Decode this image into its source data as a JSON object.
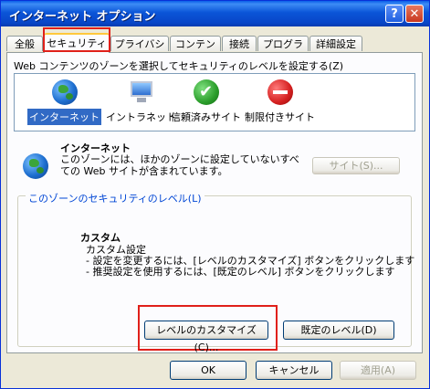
{
  "window": {
    "title": "インターネット オプション"
  },
  "titlebar": {
    "help_glyph": "?",
    "close_glyph": "✕"
  },
  "tabs": [
    {
      "label": "全般"
    },
    {
      "label": "セキュリティ",
      "active": true
    },
    {
      "label": "プライバシー"
    },
    {
      "label": "コンテンツ"
    },
    {
      "label": "接続"
    },
    {
      "label": "プログラム"
    },
    {
      "label": "詳細設定"
    }
  ],
  "zones": {
    "instruction": "Web コンテンツのゾーンを選択してセキュリティのレベルを設定する(Z)",
    "items": [
      {
        "label": "インターネット",
        "icon": "globe-icon",
        "selected": true
      },
      {
        "label": "イントラネット",
        "icon": "computer-icon"
      },
      {
        "label": "信頼済みサイト",
        "icon": "checkmark-icon"
      },
      {
        "label": "制限付きサイト",
        "icon": "no-entry-icon"
      }
    ]
  },
  "zone_info": {
    "title": "インターネット",
    "description": "このゾーンには、ほかのゾーンに設定していないすべての Web サイトが含まれています。",
    "sites_button": "サイト(S)..."
  },
  "security_level": {
    "group_title": "このゾーンのセキュリティのレベル(L)",
    "level_name": "カスタム",
    "level_desc": "カスタム設定",
    "bullet1": "- 設定を変更するには、[レベルのカスタマイズ] ボタンをクリックします",
    "bullet2": "- 推奨設定を使用するには、[既定のレベル] ボタンをクリックします",
    "customize_button": "レベルのカスタマイズ(C)...",
    "default_button": "既定のレベル(D)"
  },
  "footer": {
    "ok": "OK",
    "cancel": "キャンセル",
    "apply": "適用(A)"
  },
  "colors": {
    "titlebar": "#0a5fe8",
    "highlight_box": "#e0201a",
    "selection": "#316ac5",
    "group_title": "#0046d5"
  }
}
